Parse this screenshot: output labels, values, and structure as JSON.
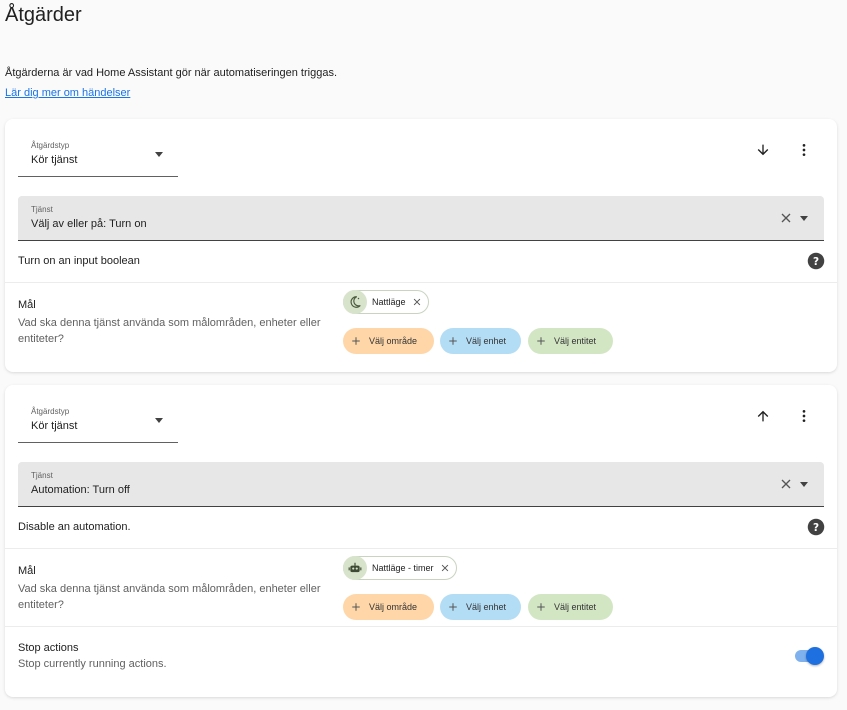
{
  "page": {
    "title": "Åtgärder",
    "intro": "Åtgärderna är vad Home Assistant gör när automatiseringen triggas.",
    "learn_more": "Lär dig mer om händelser"
  },
  "actions": [
    {
      "type_label": "Åtgärdstyp",
      "type_value": "Kör tjänst",
      "move_icon": "arrow-down-icon",
      "service_label": "Tjänst",
      "service_value": "Välj av eller på: Turn on",
      "description": "Turn on an input boolean",
      "target_title": "Mål",
      "target_desc": "Vad ska denna tjänst använda som målområden, enheter eller entiteter?",
      "entity_chip": {
        "name": "Nattläge",
        "icon": "moon-icon"
      },
      "add_area": "Välj område",
      "add_device": "Välj enhet",
      "add_entity": "Välj entitet"
    },
    {
      "type_label": "Åtgärdstyp",
      "type_value": "Kör tjänst",
      "move_icon": "arrow-up-icon",
      "service_label": "Tjänst",
      "service_value": "Automation: Turn off",
      "description": "Disable an automation.",
      "target_title": "Mål",
      "target_desc": "Vad ska denna tjänst använda som målområden, enheter eller entiteter?",
      "entity_chip": {
        "name": "Nattläge - timer",
        "icon": "robot-icon"
      },
      "add_area": "Välj område",
      "add_device": "Välj enhet",
      "add_entity": "Välj entitet",
      "stop_title": "Stop actions",
      "stop_desc": "Stop currently running actions.",
      "stop_enabled": true
    }
  ],
  "colors": {
    "accent": "#1e6fe0",
    "area_chip": "#fed6a8",
    "device_chip": "#b3dcf5",
    "entity_chip": "#d3e6c4"
  }
}
